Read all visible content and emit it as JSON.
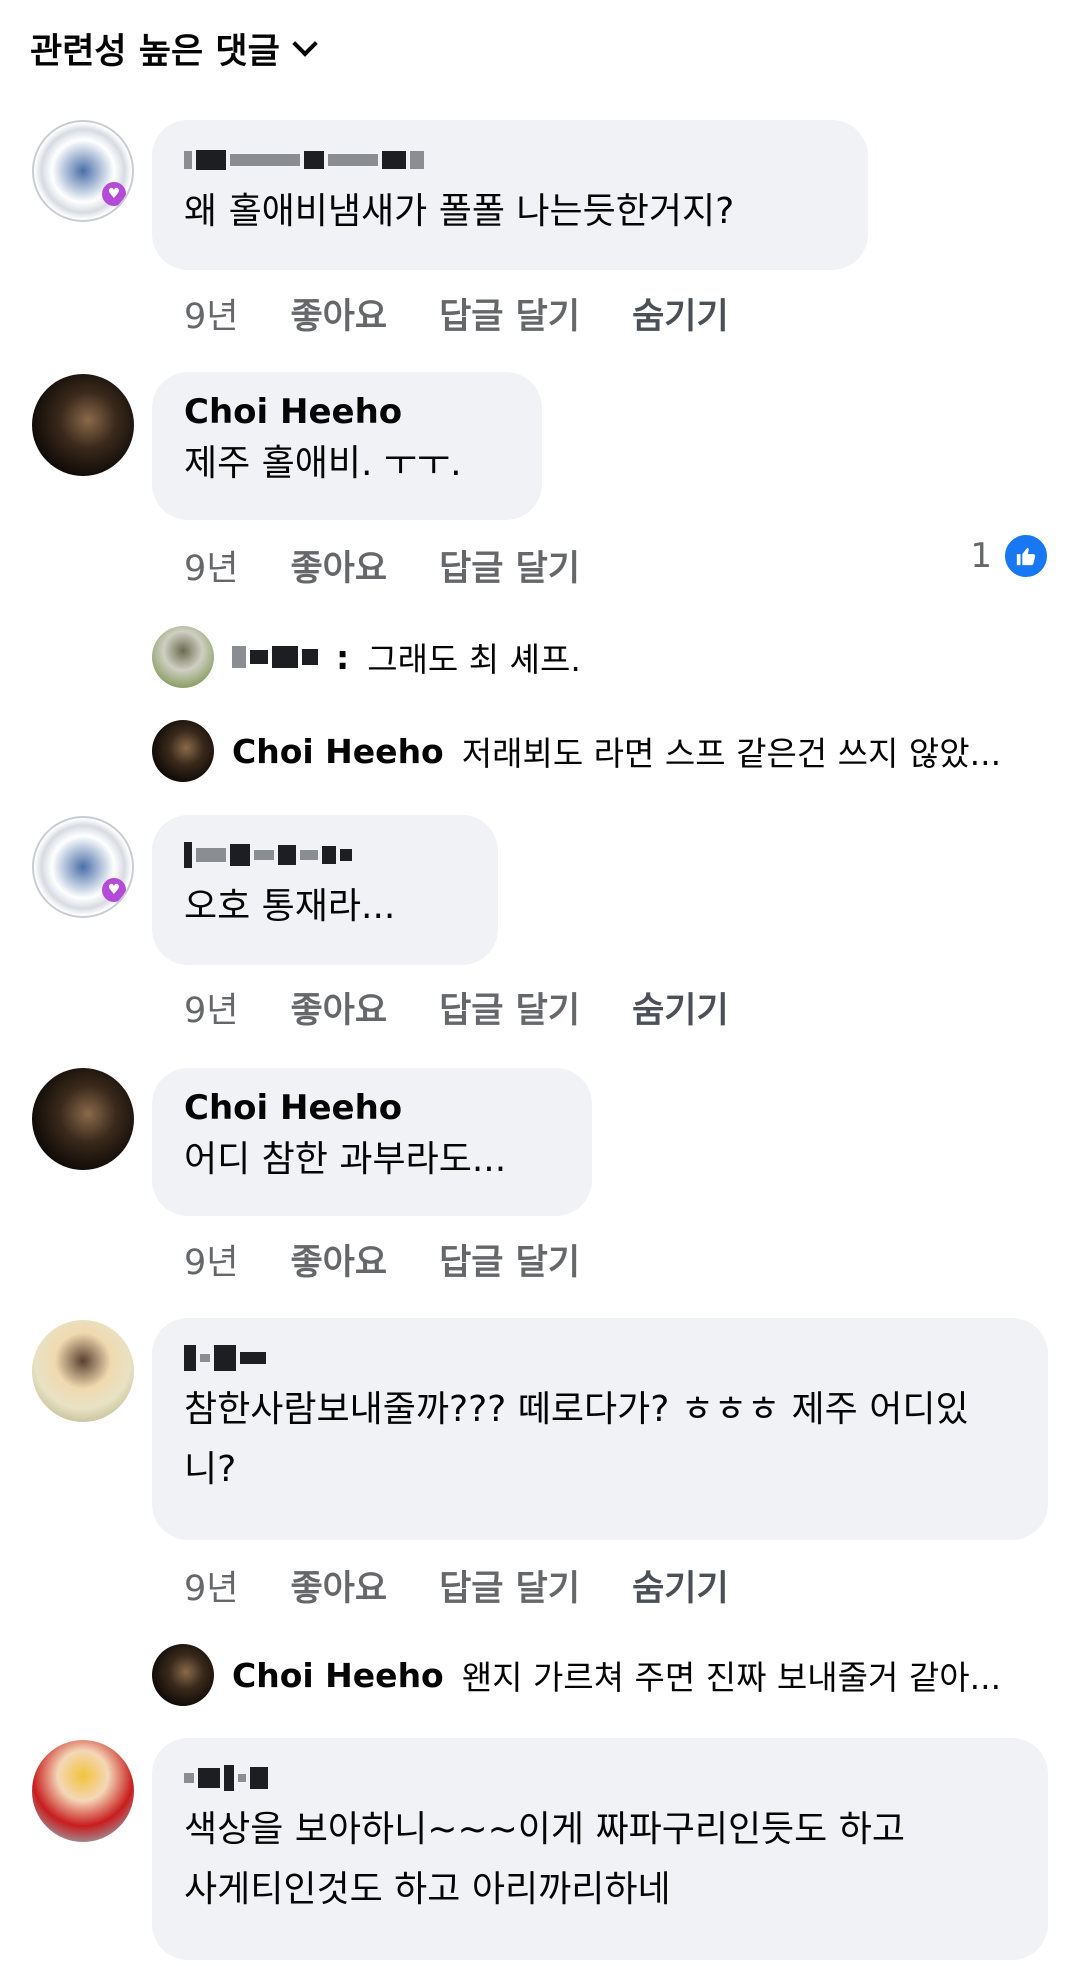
{
  "header": {
    "sort_label": "관련성 높은 댓글"
  },
  "comments": [
    {
      "author": "",
      "text": "왜 홀애비냄새가 폴폴 나는듯한거지?",
      "age": "9년",
      "like": "좋아요",
      "reply": "답글 달기",
      "hide": "숨기기"
    },
    {
      "author": "Choi Heeho",
      "text": "제주 홀애비. ㅜㅜ.",
      "age": "9년",
      "like": "좋아요",
      "reply": "답글 달기",
      "like_count": "1"
    },
    {
      "author": "",
      "text": "오호 통재라...",
      "age": "9년",
      "like": "좋아요",
      "reply": "답글 달기",
      "hide": "숨기기"
    },
    {
      "author": "Choi Heeho",
      "text": "어디 참한 과부라도...",
      "age": "9년",
      "like": "좋아요",
      "reply": "답글 달기"
    },
    {
      "author": "",
      "text": "참한사람보내줄까??? 떼로다가? ㅎㅎㅎ 제주 어디있니?",
      "age": "9년",
      "like": "좋아요",
      "reply": "답글 달기",
      "hide": "숨기기"
    },
    {
      "author": "",
      "text": "색상을 보아하니~~~이게 짜파구리인듯도 하고 사게티인것도 하고 아리까리하네"
    }
  ],
  "replies": [
    {
      "name": ":",
      "snippet": "그래도 최 셰프."
    },
    {
      "name": "Choi Heeho",
      "snippet": "저래뵈도 라면 스프 같은건 쓰지 않았..."
    },
    {
      "name": "Choi Heeho",
      "snippet": "왠지 가르쳐 주면 진짜 보내줄거 같아..."
    }
  ]
}
